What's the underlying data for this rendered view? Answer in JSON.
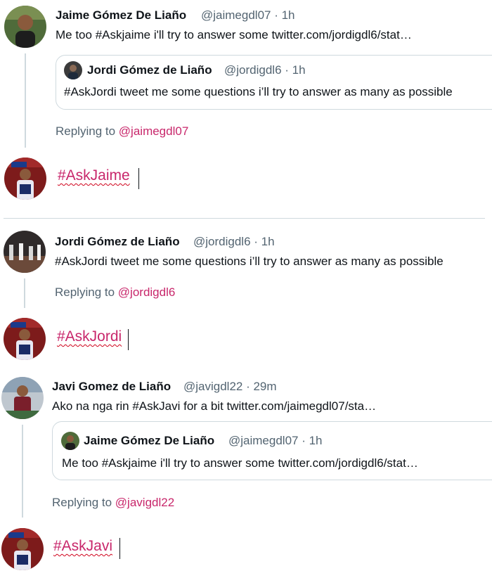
{
  "thread1": {
    "author_name": "Jaime Gómez De Liaño",
    "author_meta": "@jaimegdl07 · 1h",
    "text": "Me too #Askjaime i'll try to answer some twitter.com/jordigdl6/stat…",
    "quote": {
      "author_name": "Jordi Gómez de Liaño",
      "author_meta": "@jordigdl6 · 1h",
      "text": "#AskJordi tweet me some questions i’ll try to answer as many as possible"
    },
    "replying_label": "Replying to",
    "replying_handle": "@jaimegdl07",
    "compose_text": "#AskJaime"
  },
  "thread2": {
    "author_name": "Jordi Gómez de Liaño",
    "author_meta": "@jordigdl6 · 1h",
    "text": "#AskJordi tweet me some questions i’ll try to answer as many as possible",
    "replying_label": "Replying to",
    "replying_handle": "@jordigdl6",
    "compose_text": "#AskJordi"
  },
  "thread3": {
    "author_name": "Javi Gomez de Liaño",
    "author_meta": "@javigdl22 · 29m",
    "text": "Ako na nga rin #AskJavi for a bit twitter.com/jaimegdl07/sta…",
    "quote": {
      "author_name": "Jaime Gómez De Liaño",
      "author_meta": "@jaimegdl07 · 1h",
      "text": "Me too #Askjaime i'll try to answer some twitter.com/jordigdl6/stat…"
    },
    "replying_label": "Replying to",
    "replying_handle": "@javigdl22",
    "compose_text": "#AskJavi"
  },
  "colors": {
    "accent": "#c8276b",
    "secondary_text": "#536471",
    "border": "#cfd9de"
  }
}
